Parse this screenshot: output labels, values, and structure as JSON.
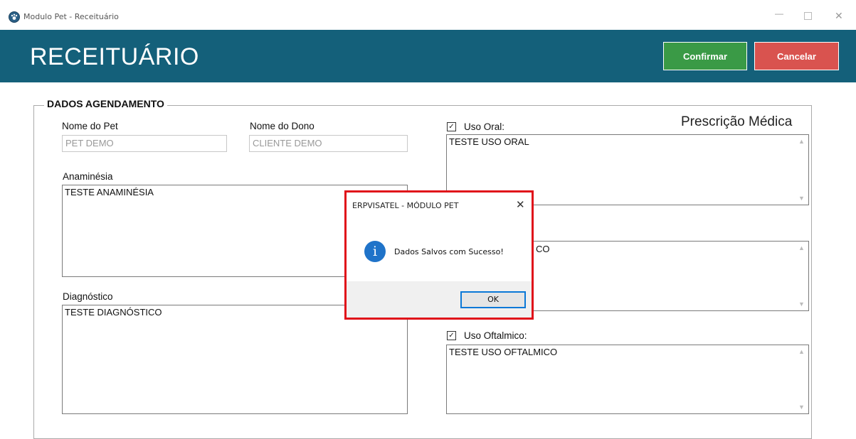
{
  "window": {
    "title": "Modulo Pet - Receituário",
    "icon": "paw-icon",
    "controls": {
      "minimize": "—",
      "maximize": "",
      "close": "✕"
    }
  },
  "header": {
    "title": "RECEITUÁRIO",
    "confirm_label": "Confirmar",
    "cancel_label": "Cancelar",
    "colors": {
      "background": "#14607a",
      "confirm": "#3a9a46",
      "cancel": "#d9534f"
    }
  },
  "form": {
    "group_title": "DADOS AGENDAMENTO",
    "pet_name": {
      "label": "Nome do Pet",
      "value": "PET DEMO"
    },
    "owner_name": {
      "label": "Nome do Dono",
      "value": "CLIENTE DEMO"
    },
    "anamnesis": {
      "label": "Anaminésia",
      "value": "TESTE ANAMINÉSIA"
    },
    "diagnosis": {
      "label": "Diagnóstico",
      "value": "TESTE DIAGNÓSTICO"
    }
  },
  "prescription": {
    "title": "Prescrição Médica",
    "oral": {
      "label": "Uso Oral:",
      "checked": true,
      "value": "TESTE USO ORAL"
    },
    "hidden": {
      "value_visible": "CO"
    },
    "ophthalmic": {
      "label": "Uso Oftalmico:",
      "checked": true,
      "value": "TESTE USO OFTALMICO"
    }
  },
  "dialog": {
    "title": "ERPVISATEL - MÓDULO PET",
    "close": "✕",
    "icon": "info-icon",
    "message": "Dados Salvos com Sucesso!",
    "ok_label": "OK"
  }
}
